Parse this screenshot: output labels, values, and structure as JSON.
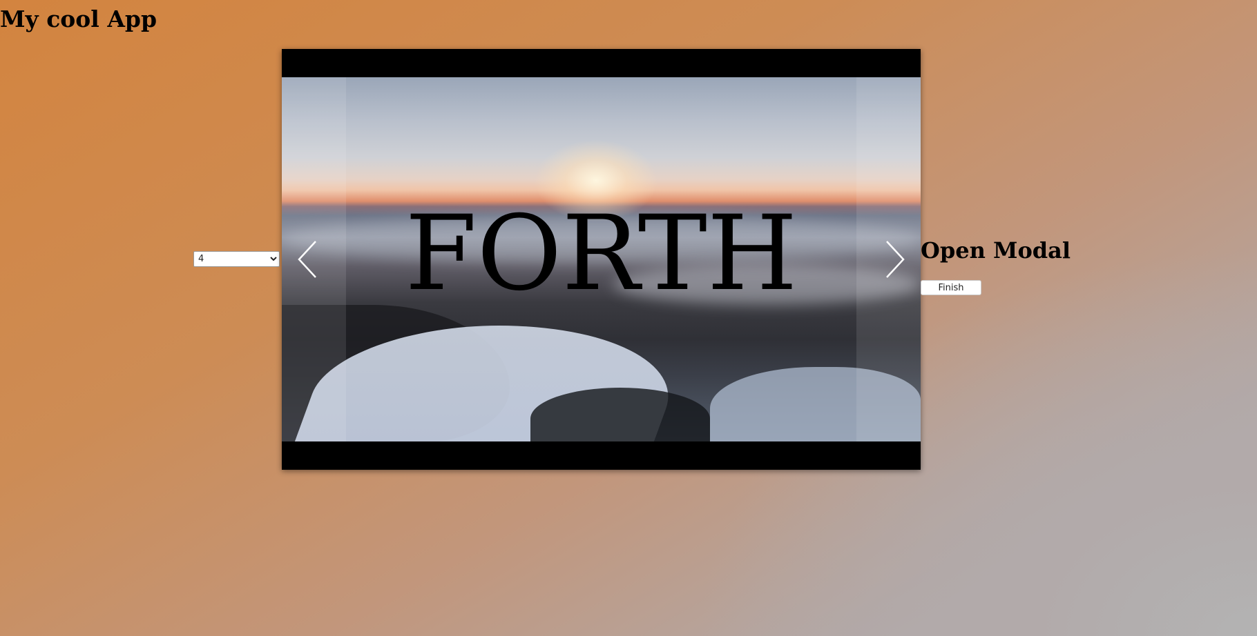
{
  "app": {
    "title": "My cool App"
  },
  "slide_select": {
    "selected": "4",
    "options": [
      "4"
    ]
  },
  "carousel": {
    "caption": "FORTH",
    "prev_icon": "chevron-left-icon",
    "next_icon": "chevron-right-icon",
    "arrow_color": "#ffffff"
  },
  "modal": {
    "heading": "Open Modal",
    "finish_label": "Finish"
  },
  "colors": {
    "background_top": "#d3843f",
    "background_bottom": "#b3b3b3",
    "carousel_frame": "#000000"
  }
}
